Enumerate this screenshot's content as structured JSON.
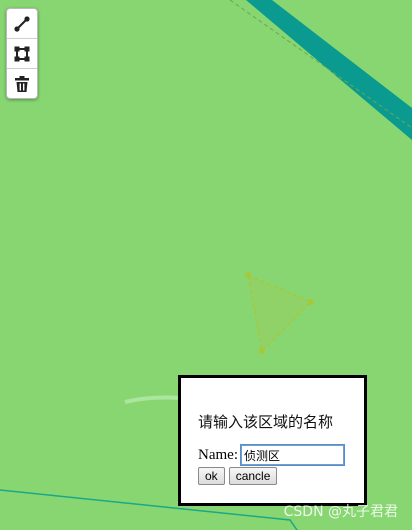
{
  "toolbar": {
    "items": [
      {
        "icon": "draw-line-icon",
        "label": ""
      },
      {
        "icon": "draw-polygon-icon",
        "label": ""
      },
      {
        "icon": "trash-icon",
        "label": ""
      }
    ]
  },
  "dialog": {
    "title": "请输入该区域的名称",
    "name_label": "Name:",
    "name_value": "侦测区",
    "ok_label": "ok",
    "cancel_label": "cancle"
  },
  "watermark": "CSDN @丸子君君",
  "colors": {
    "map_background": "#87d672",
    "river": "#0a9a8f",
    "polygon_stroke": "#a7c83a",
    "teal_line": "#1aa888"
  }
}
